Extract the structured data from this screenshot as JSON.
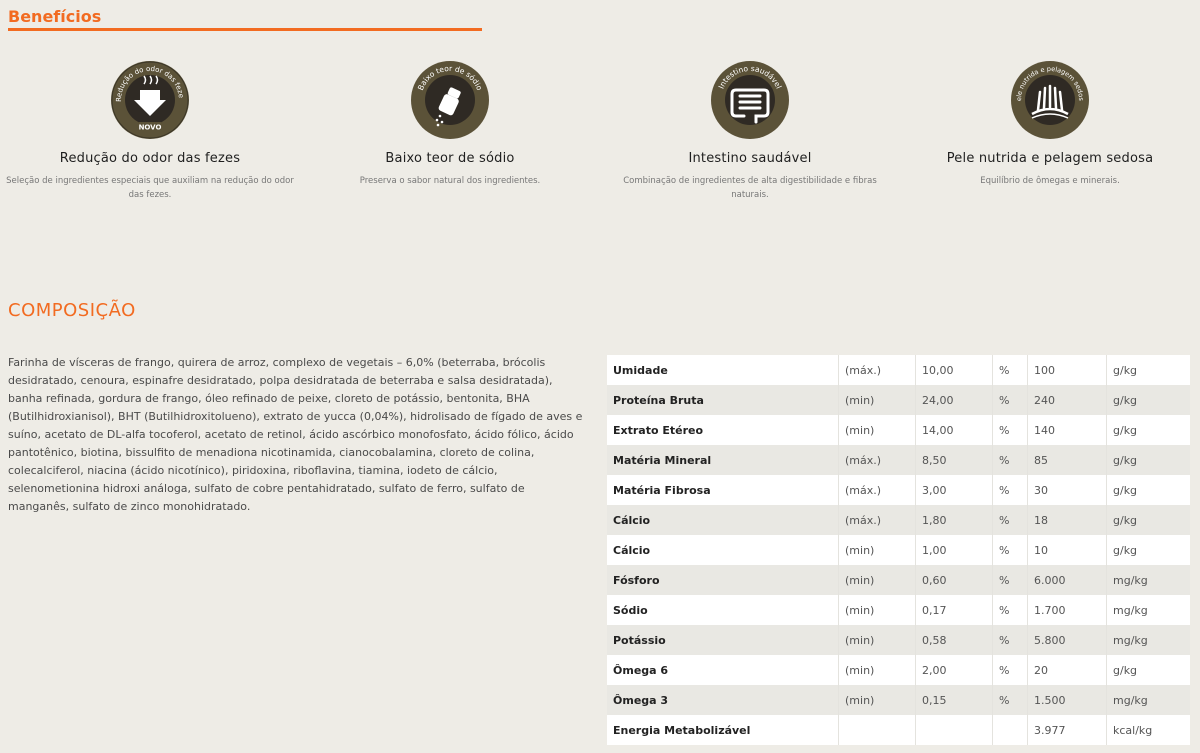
{
  "sections": {
    "beneficios_title": "Benefícios",
    "composicao_title": "COMPOSIÇÃO"
  },
  "colors": {
    "accent": "#f26b21",
    "icon_ring": "#5b5238",
    "icon_inner": "#2f2a24"
  },
  "benefits": [
    {
      "icon": "odor-reduction-icon",
      "ring_text": "Redução do odor das fezes",
      "badge": "NOVO",
      "title": "Redução do odor das fezes",
      "description": "Seleção de ingredientes especiais que auxiliam na redução do odor das fezes."
    },
    {
      "icon": "salt-shaker-icon",
      "ring_text": "Baixo teor de sódio",
      "title": "Baixo teor de sódio",
      "description": "Preserva o sabor natural dos ingredientes."
    },
    {
      "icon": "intestine-icon",
      "ring_text": "Intestino saudável",
      "title": "Intestino saudável",
      "description": "Combinação de ingredientes de alta digestibilidade e fibras naturais."
    },
    {
      "icon": "skin-hair-icon",
      "ring_text": "Pele nutrida e pelagem sedosa",
      "title": "Pele nutrida e pelagem sedosa",
      "description": "Equilíbrio de ômegas e minerais."
    }
  ],
  "composition_text": "Farinha de vísceras de frango, quirera de arroz, complexo de vegetais – 6,0% (beterraba, brócolis desidratado, cenoura, espinafre desidratado, polpa desidratada de beterraba e salsa desidratada), banha refinada, gordura de frango, óleo refinado de peixe, cloreto de potássio, bentonita, BHA (Butilhidroxianisol), BHT (Butilhidroxitolueno), extrato de yucca (0,04%), hidrolisado de fígado de aves e suíno, acetato de DL-alfa tocoferol, acetato de retinol, ácido ascórbico monofosfato, ácido fólico, ácido pantotênico, biotina, bissulfito de menadiona nicotinamida, cianocobalamina, cloreto de colina, colecalciferol, niacina (ácido nicotínico), piridoxina, riboflavina, tiamina, iodeto de cálcio, selenometionina hidroxi análoga, sulfato de cobre pentahidratado, sulfato de ferro, sulfato de manganês, sulfato de zinco monohidratado.",
  "nutrition": [
    {
      "name": "Umidade",
      "limit": "(máx.)",
      "pct": "10,00",
      "sym": "%",
      "amount": "100",
      "unit": "g/kg"
    },
    {
      "name": "Proteína Bruta",
      "limit": "(min)",
      "pct": "24,00",
      "sym": "%",
      "amount": "240",
      "unit": "g/kg"
    },
    {
      "name": "Extrato Etéreo",
      "limit": "(min)",
      "pct": "14,00",
      "sym": "%",
      "amount": "140",
      "unit": "g/kg"
    },
    {
      "name": "Matéria Mineral",
      "limit": "(máx.)",
      "pct": "8,50",
      "sym": "%",
      "amount": "85",
      "unit": "g/kg"
    },
    {
      "name": "Matéria Fibrosa",
      "limit": "(máx.)",
      "pct": "3,00",
      "sym": "%",
      "amount": "30",
      "unit": "g/kg"
    },
    {
      "name": "Cálcio",
      "limit": "(máx.)",
      "pct": "1,80",
      "sym": "%",
      "amount": "18",
      "unit": "g/kg"
    },
    {
      "name": "Cálcio",
      "limit": "(min)",
      "pct": "1,00",
      "sym": "%",
      "amount": "10",
      "unit": "g/kg"
    },
    {
      "name": "Fósforo",
      "limit": "(min)",
      "pct": "0,60",
      "sym": "%",
      "amount": "6.000",
      "unit": "mg/kg"
    },
    {
      "name": "Sódio",
      "limit": "(min)",
      "pct": "0,17",
      "sym": "%",
      "amount": "1.700",
      "unit": "mg/kg"
    },
    {
      "name": "Potássio",
      "limit": "(min)",
      "pct": "0,58",
      "sym": "%",
      "amount": "5.800",
      "unit": "mg/kg"
    },
    {
      "name": "Ômega 6",
      "limit": "(min)",
      "pct": "2,00",
      "sym": "%",
      "amount": "20",
      "unit": "g/kg"
    },
    {
      "name": "Ômega 3",
      "limit": "(min)",
      "pct": "0,15",
      "sym": "%",
      "amount": "1.500",
      "unit": "mg/kg"
    },
    {
      "name": "Energia Metabolizável",
      "limit": "",
      "pct": "",
      "sym": "",
      "amount": "3.977",
      "unit": "kcal/kg"
    }
  ]
}
